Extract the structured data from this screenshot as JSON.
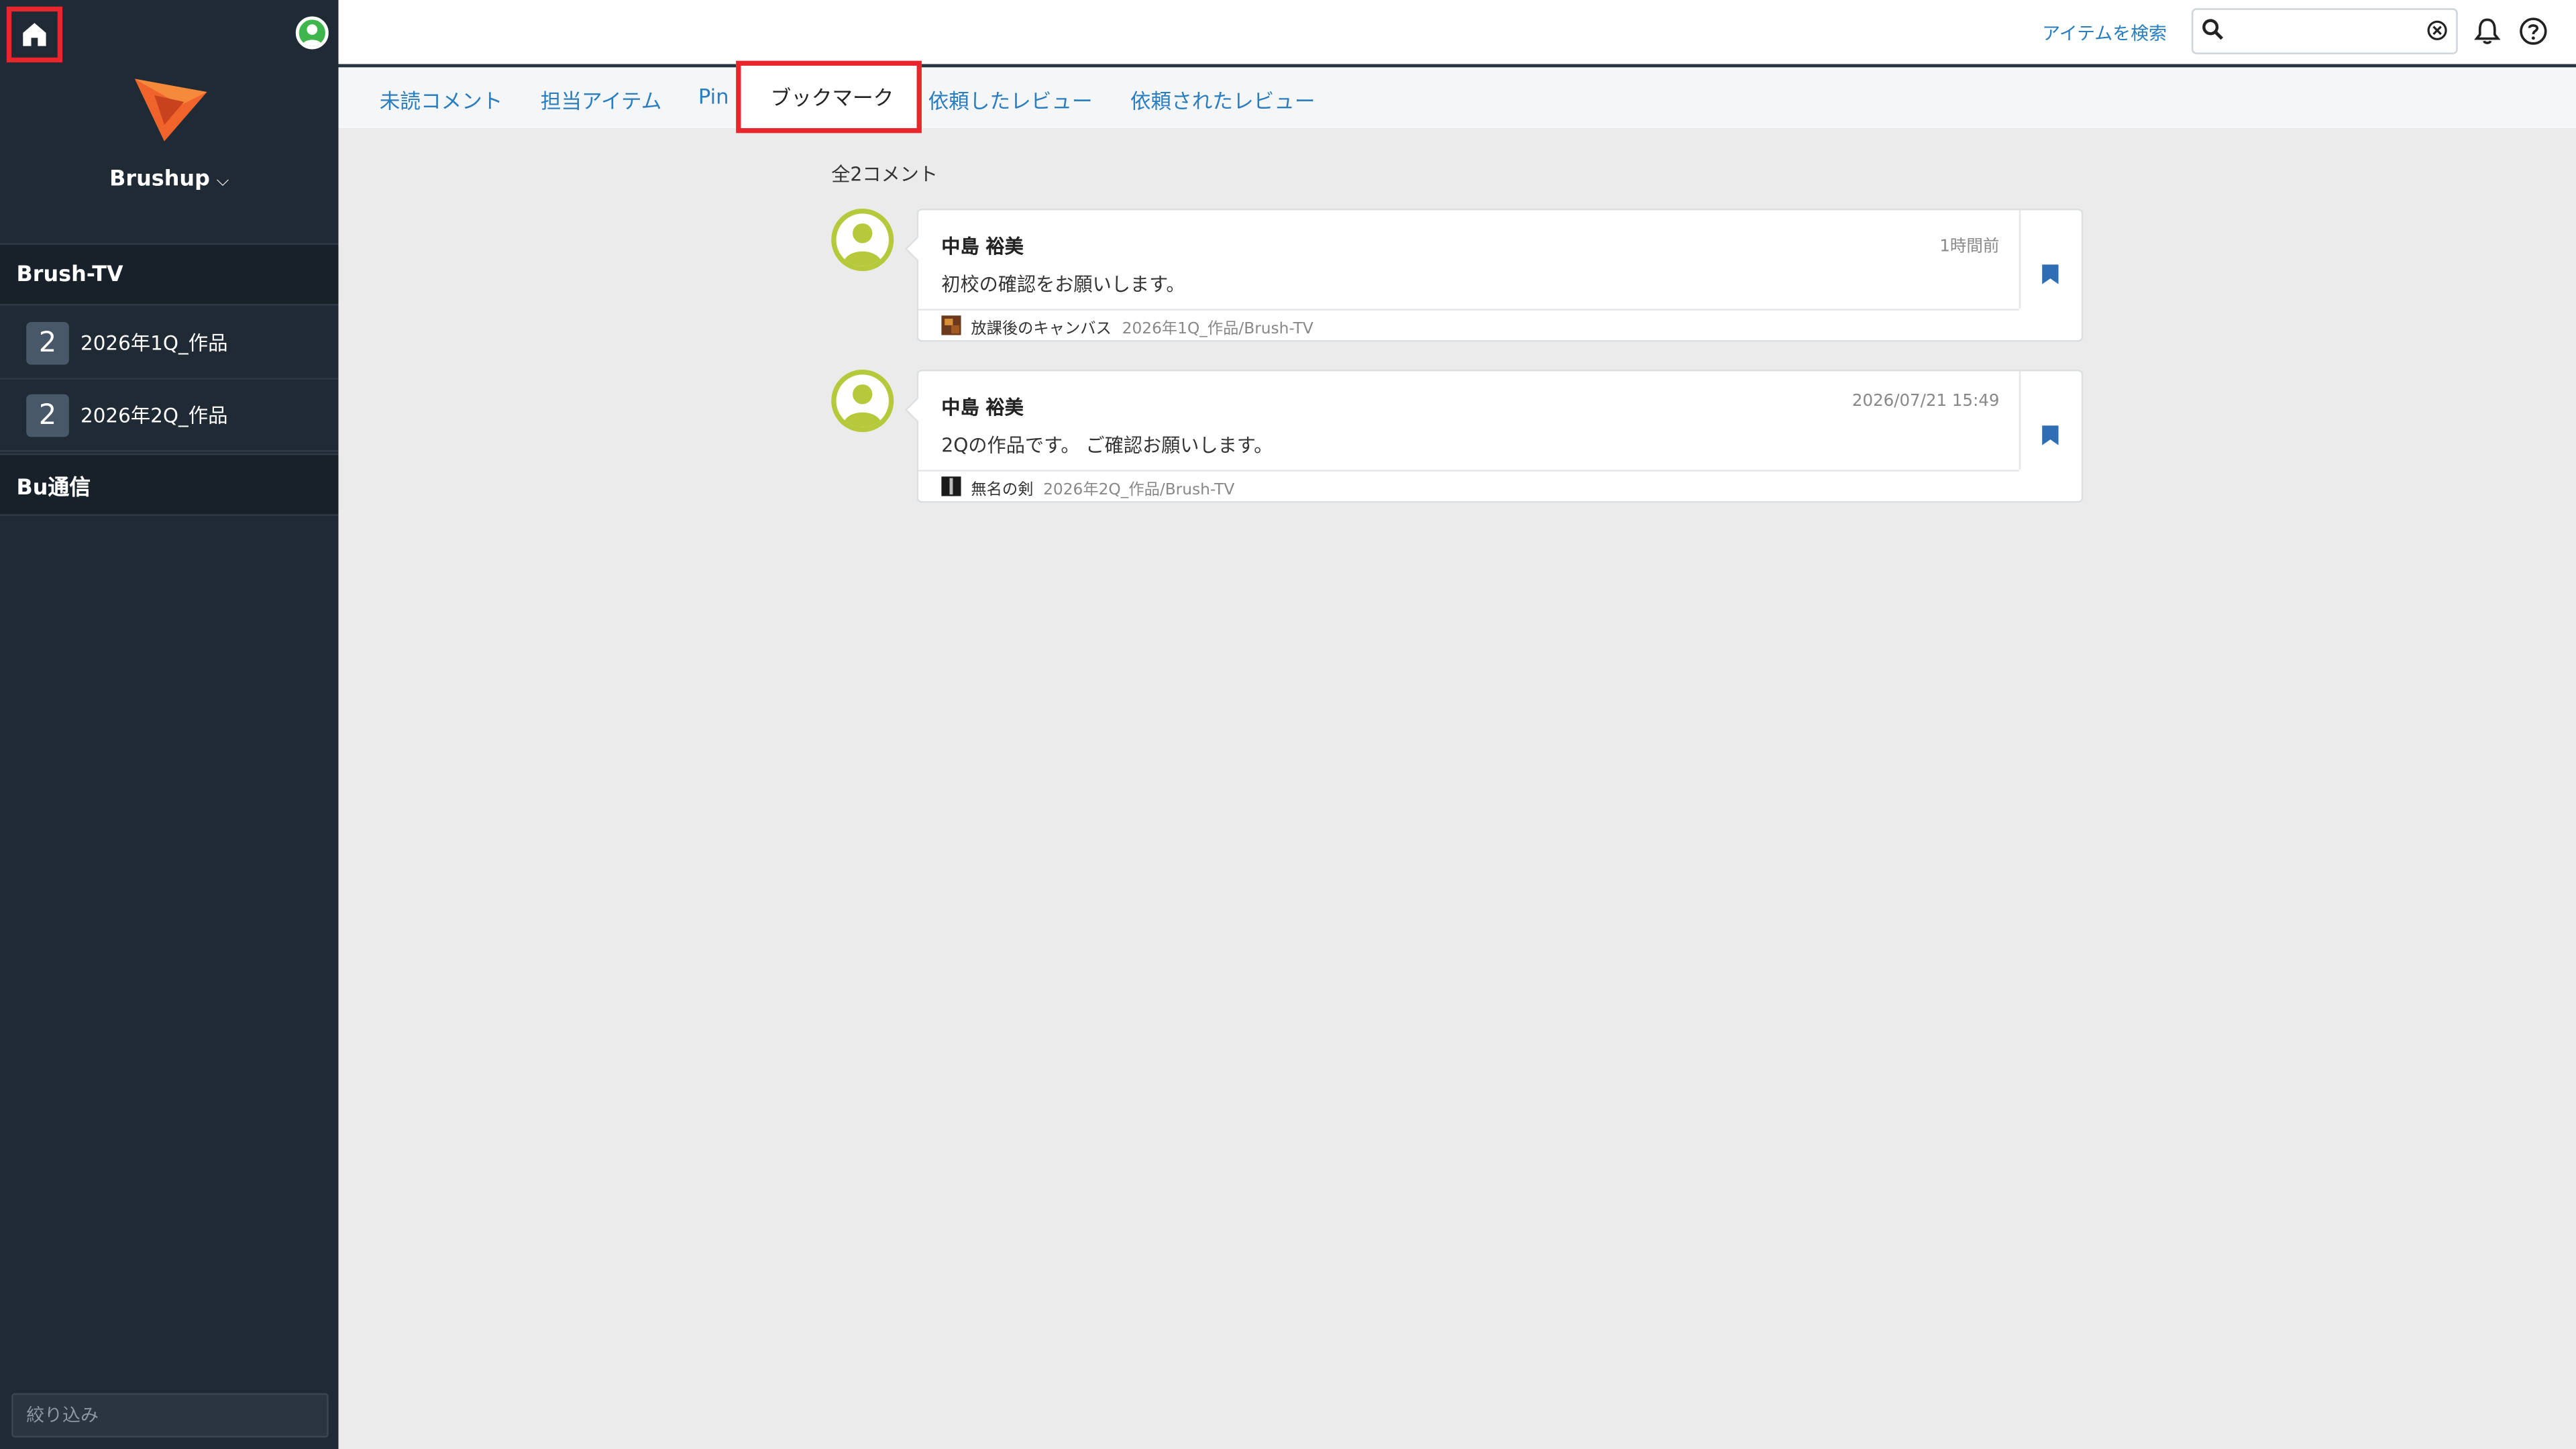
{
  "sidebar": {
    "brand": "Brushup",
    "groups": [
      {
        "label": "Brush-TV"
      },
      {
        "label": "Bu通信"
      }
    ],
    "projects": [
      {
        "count": "2",
        "label": "2026年1Q_作品"
      },
      {
        "count": "2",
        "label": "2026年2Q_作品"
      }
    ],
    "filter_placeholder": "絞り込み"
  },
  "header": {
    "search_link": "アイテムを検索",
    "search_value": ""
  },
  "tabs": [
    {
      "label": "未読コメント"
    },
    {
      "label": "担当アイテム"
    },
    {
      "label": "Pin"
    },
    {
      "label": "ブックマーク",
      "active": true
    },
    {
      "label": "依頼したレビュー"
    },
    {
      "label": "依頼されたレビュー"
    }
  ],
  "main": {
    "count_label": "全2コメント",
    "comments": [
      {
        "author": "中島 裕美",
        "time": "1時間前",
        "text": "初校の確認をお願いします。",
        "item": "放課後のキャンバス",
        "path": "2026年1Q_作品/Brush-TV"
      },
      {
        "author": "中島 裕美",
        "time": "2026/07/21 15:49",
        "text": "2Qの作品です。 ご確認お願いします。",
        "item": "無名の剣",
        "path": "2026年2Q_作品/Brush-TV"
      }
    ]
  },
  "colors": {
    "sidebar_bg": "#1f2a35",
    "accent_link": "#2a7dbf",
    "highlight_red": "#e8262b",
    "avatar_ring": "#b5c93b",
    "bookmark_blue": "#2f6db5"
  },
  "icons": [
    "home-icon",
    "user-avatar-icon",
    "brushup-logo",
    "chevron-down-icon",
    "search-icon",
    "clear-icon",
    "bell-icon",
    "help-icon",
    "bookmark-icon"
  ]
}
